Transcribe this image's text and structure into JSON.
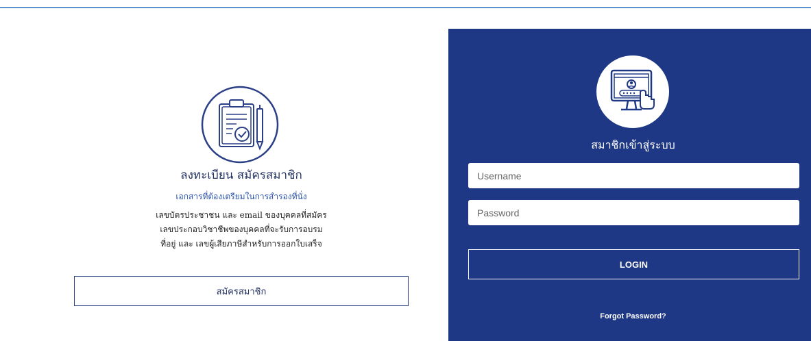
{
  "colors": {
    "panel_bg": "#1e3885",
    "accent_line": "#5a8fd0",
    "text_dark": "#1f2f5e",
    "subtitle_blue": "#2f55a8"
  },
  "register": {
    "icon": "clipboard-check-icon",
    "title": "ลงทะเบียน สมัครสมาชิก",
    "subtitle": "เอกสารที่ต้องเตรียมในการสำรองที่นั่ง",
    "description_lines": [
      "เลขบัตรประชาชน และ email ของบุคคลที่สมัคร",
      "เลขประกอบวิชาชีพของบุคคลที่จะรับการอบรม",
      "ที่อยู่ และ เลขผู้เสียภาษีสำหรับการออกใบเสร็จ"
    ],
    "button_label": "สมัครสมาชิก"
  },
  "login": {
    "icon": "computer-user-login-icon",
    "title": "สมาชิกเข้าสู่ระบบ",
    "username_placeholder": "Username",
    "username_value": "",
    "password_placeholder": "Password",
    "password_value": "",
    "button_label": "LOGIN",
    "forgot_label": "Forgot Password?"
  }
}
